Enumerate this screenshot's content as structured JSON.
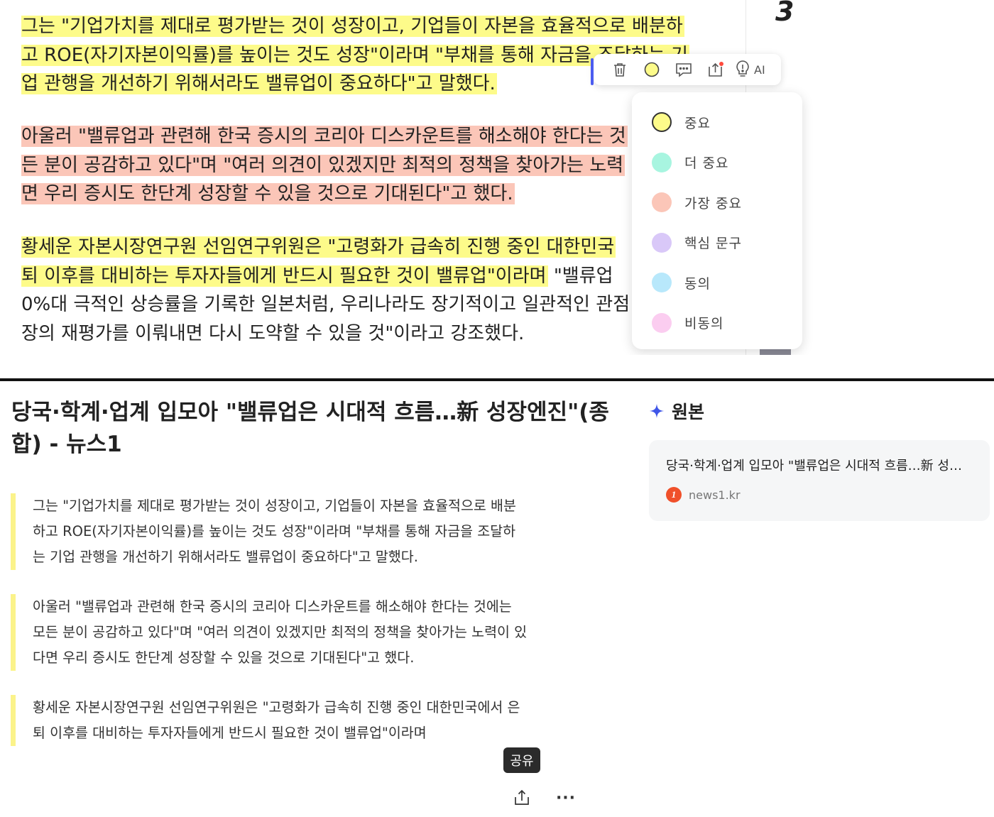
{
  "top_view": {
    "page_number": "3",
    "paragraphs": [
      {
        "highlight": "yellow",
        "lines": [
          "그는 \"기업가치를 제대로 평가받는 것이 성장이고, 기업들이 자본을 효율적으로 배분하",
          "고 ROE(자기자본이익률)를 높이는 것도 성장\"이라며 \"부채를 통해 자금을 조달하는 기",
          "업 관행을 개선하기 위해서라도 밸류업이 중요하다\"고 말했다."
        ]
      },
      {
        "highlight": "pink",
        "lines": [
          "아울러 \"밸류업과 관련해 한국 증시의 코리아 디스카운트를 해소해야 한다는 것",
          "든 분이 공감하고 있다\"며 \"여러 의견이 있겠지만 최적의 정책을 찾아가는 노력",
          "면 우리 증시도 한단계 성장할 수 있을 것으로 기대된다\"고 했다."
        ]
      },
      {
        "highlight": "mixed",
        "lines": [
          "황세운 자본시장연구원 선임연구위원은 \"고령화가 급속히 진행 중인 대한민국",
          "퇴 이후를 대비하는 투자자들에게 반드시 필요한 것이 밸류업\"이라며",
          "0%대 극적인 상승률을 기록한 일본처럼, 우리나라도 장기적이고 일관적인 관점",
          "장의 재평가를 이뤄내면 다시 도약할 수 있을 것\"이라고 강조했다."
        ],
        "unhighlighted_tail": " \"밸류업"
      }
    ],
    "toolbar": {
      "delete_icon": "trash-icon",
      "color_icon": "color-circle-icon",
      "memo_icon": "memo-icon",
      "share_icon": "share-box-icon",
      "ai_icon": "lightbulb-icon",
      "ai_label": "AI"
    },
    "color_menu": [
      {
        "label": "중요",
        "color": "#fdfb8a",
        "selected": true
      },
      {
        "label": "더 중요",
        "color": "#a8f5e0"
      },
      {
        "label": "가장 중요",
        "color": "#fbc6b8"
      },
      {
        "label": "핵심 문구",
        "color": "#d9c8f8"
      },
      {
        "label": "동의",
        "color": "#b8e8fb"
      },
      {
        "label": "비동의",
        "color": "#fbcdf0"
      }
    ]
  },
  "reader": {
    "title_lines": [
      "당국·학계·업계 입모아 \"밸류업은 시대적 흐름…新 성장엔진\"(종",
      "합) - 뉴스1"
    ],
    "quotes": [
      [
        "그는 \"기업가치를 제대로 평가받는 것이 성장이고, 기업들이 자본을 효율적으로 배분",
        "하고 ROE(자기자본이익률)를 높이는 것도 성장\"이라며 \"부채를 통해 자금을 조달하",
        "는 기업 관행을 개선하기 위해서라도 밸류업이 중요하다\"고 말했다."
      ],
      [
        "아울러 \"밸류업과 관련해 한국 증시의 코리아 디스카운트를 해소해야 한다는 것에는",
        "모든 분이 공감하고 있다\"며 \"여러 의견이 있겠지만 최적의 정책을 찾아가는 노력이 있",
        "다면 우리 증시도 한단계 성장할 수 있을 것으로 기대된다\"고 했다."
      ],
      [
        "황세운 자본시장연구원 선임연구위원은 \"고령화가 급속히 진행 중인 대한민국에서 은",
        "퇴 이후를 대비하는 투자자들에게 반드시 필요한 것이 밸류업\"이라며"
      ]
    ],
    "share_tooltip": "공유",
    "more_label": "···",
    "source": {
      "heading": "원본",
      "card_title": "당국·학계·업계 입모아 \"밸류업은 시대적 흐름…新 성장…",
      "site": "news1.kr"
    }
  },
  "colors": {
    "accent": "#4b5cf0",
    "highlight_yellow": "#fdfb8a",
    "highlight_pink": "#fbc6b8",
    "quote_bar": "#fbf38a",
    "site_logo": "#f0502a"
  }
}
